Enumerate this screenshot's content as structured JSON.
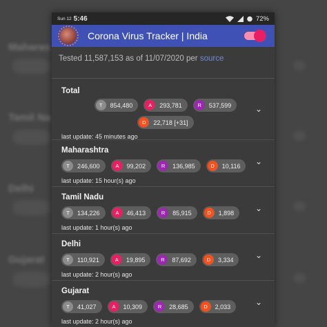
{
  "status_bar": {
    "date": "Sun 12",
    "time": "5:46",
    "battery": "72%"
  },
  "app_bar": {
    "title": "Corona Virus Tracker | India"
  },
  "tested": {
    "text": "Tested 11,587,153 as of 11/07/2020 per",
    "link": "source"
  },
  "cards": [
    {
      "name": "Total",
      "tested": "854,480",
      "active": "293,781",
      "recovered": "537,599",
      "deceased": "22,718 [+31]",
      "updated": "last update: 45 minutes ago"
    },
    {
      "name": "Maharashtra",
      "tested": "246,600",
      "active": "99,202",
      "recovered": "136,985",
      "deceased": "10,116",
      "updated": "last update: 15 hour(s) ago"
    },
    {
      "name": "Tamil Nadu",
      "tested": "134,226",
      "active": "46,413",
      "recovered": "85,915",
      "deceased": "1,898",
      "updated": "last update: 1 hour(s) ago"
    },
    {
      "name": "Delhi",
      "tested": "110,921",
      "active": "19,895",
      "recovered": "87,692",
      "deceased": "3,334",
      "updated": "last update: 2 hour(s) ago"
    },
    {
      "name": "Gujarat",
      "tested": "41,027",
      "active": "10,309",
      "recovered": "28,685",
      "deceased": "2,033",
      "updated": "last update: 2 hour(s) ago"
    }
  ],
  "badge_letters": {
    "tested": "T",
    "active": "A",
    "recovered": "R",
    "deceased": "D"
  },
  "colors": {
    "app_bar": "#3f51b5",
    "active": "#e91e63",
    "recovered": "#9c27b0",
    "deceased": "#f4511e",
    "tested": "#8c8c8c"
  },
  "icons": [
    "virus-logo-icon",
    "wifi-icon",
    "signal-icon",
    "battery-icon",
    "chevron-down-icon"
  ]
}
